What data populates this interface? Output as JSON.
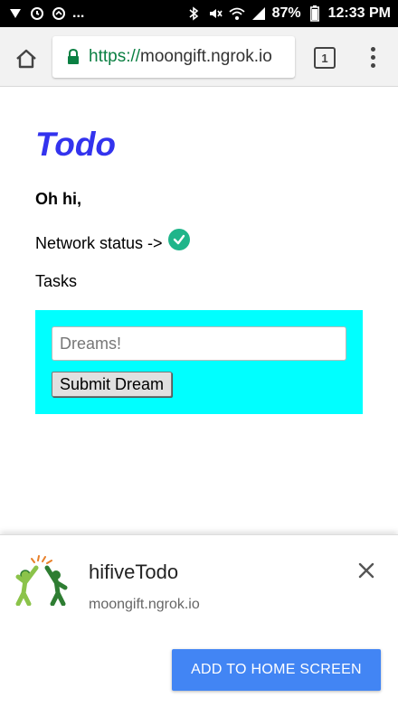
{
  "status_bar": {
    "ellipsis": "...",
    "battery": "87%",
    "time": "12:33 PM",
    "icons": [
      "cast-icon",
      "alarm-icon",
      "sync-icon",
      "bluetooth-icon",
      "mute-icon",
      "wifi-icon",
      "signal-icon",
      "battery-icon"
    ]
  },
  "browser": {
    "url_scheme": "https://",
    "url_host": "moongift.ngrok.io",
    "tab_count": "1",
    "secure_color": "#0b8043"
  },
  "page": {
    "title": "Todo",
    "greeting": "Oh hi,",
    "network_status_label": "Network status ->",
    "tasks_label": "Tasks",
    "input_placeholder": "Dreams!",
    "submit_label": "Submit Dream",
    "title_color": "#3333ee",
    "panel_color": "#00ffff",
    "status_ok_color": "#1fb58a"
  },
  "install_banner": {
    "app_name": "hifiveTodo",
    "app_host": "moongift.ngrok.io",
    "add_button_label": "ADD TO HOME SCREEN",
    "button_color": "#4285f4"
  }
}
